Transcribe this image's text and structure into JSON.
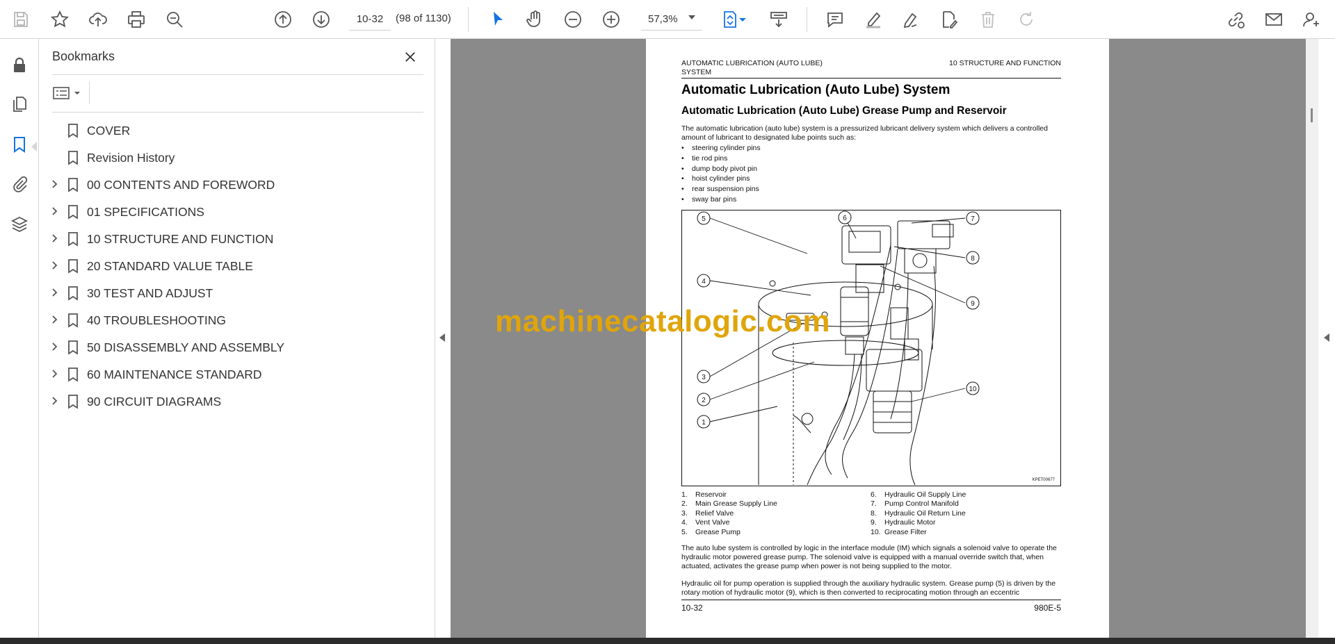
{
  "toolbar": {
    "page_value": "10-32",
    "page_count": "(98 of 1130)",
    "zoom_value": "57,3%"
  },
  "colors": {
    "accent": "#1473e6",
    "watermark": "#e0a50a",
    "viewport_bg": "#8a8a8a"
  },
  "bookmarks": {
    "title": "Bookmarks",
    "items": [
      {
        "label": "COVER",
        "expandable": false
      },
      {
        "label": "Revision History",
        "expandable": false
      },
      {
        "label": "00 CONTENTS AND FOREWORD",
        "expandable": true
      },
      {
        "label": "01 SPECIFICATIONS",
        "expandable": true
      },
      {
        "label": "10 STRUCTURE AND FUNCTION",
        "expandable": true
      },
      {
        "label": "20 STANDARD VALUE TABLE",
        "expandable": true
      },
      {
        "label": "30 TEST AND ADJUST",
        "expandable": true
      },
      {
        "label": "40 TROUBLESHOOTING",
        "expandable": true
      },
      {
        "label": "50 DISASSEMBLY AND ASSEMBLY",
        "expandable": true
      },
      {
        "label": "60 MAINTENANCE STANDARD",
        "expandable": true
      },
      {
        "label": "90 CIRCUIT DIAGRAMS",
        "expandable": true
      }
    ]
  },
  "document": {
    "header_left": "AUTOMATIC LUBRICATION (AUTO LUBE) SYSTEM",
    "header_right": "10 STRUCTURE AND FUNCTION",
    "title": "Automatic Lubrication (Auto Lube) System",
    "subtitle": "Automatic Lubrication (Auto Lube) Grease Pump and Reservoir",
    "intro": "The automatic lubrication (auto lube) system is a pressurized lubricant delivery system which delivers a controlled amount of lubricant to designated lube points such as:",
    "bullets": [
      "steering cylinder pins",
      "tie rod pins",
      "dump body pivot pin",
      "hoist cylinder pins",
      "rear suspension pins",
      "sway bar pins"
    ],
    "figure_code": "KPET00677",
    "figure_callouts": [
      "1",
      "2",
      "3",
      "4",
      "5",
      "6",
      "7",
      "8",
      "9",
      "10"
    ],
    "legend_left": [
      {
        "num": "1.",
        "text": "Reservoir"
      },
      {
        "num": "2.",
        "text": "Main Grease Supply Line"
      },
      {
        "num": "3.",
        "text": "Relief Valve"
      },
      {
        "num": "4.",
        "text": "Vent Valve"
      },
      {
        "num": "5.",
        "text": "Grease Pump"
      }
    ],
    "legend_right": [
      {
        "num": "6.",
        "text": "Hydraulic Oil Supply Line"
      },
      {
        "num": "7.",
        "text": "Pump Control Manifold"
      },
      {
        "num": "8.",
        "text": "Hydraulic Oil Return Line"
      },
      {
        "num": "9.",
        "text": "Hydraulic Motor"
      },
      {
        "num": "10.",
        "text": "Grease Filter"
      }
    ],
    "para1": "The auto lube system is controlled by logic in the interface module (IM) which signals a solenoid valve to operate the hydraulic motor powered grease pump. The solenoid valve is equipped with a manual override switch that, when actuated, activates the grease pump when power is not being supplied to the motor.",
    "para2": "Hydraulic oil for pump operation is supplied through the auxiliary hydraulic system. Grease pump (5) is driven by the rotary motion of hydraulic motor (9), which is then converted to reciprocating motion through an eccentric",
    "footer_left": "10-32",
    "footer_right": "980E-5"
  },
  "watermark": "machinecatalogic.com"
}
